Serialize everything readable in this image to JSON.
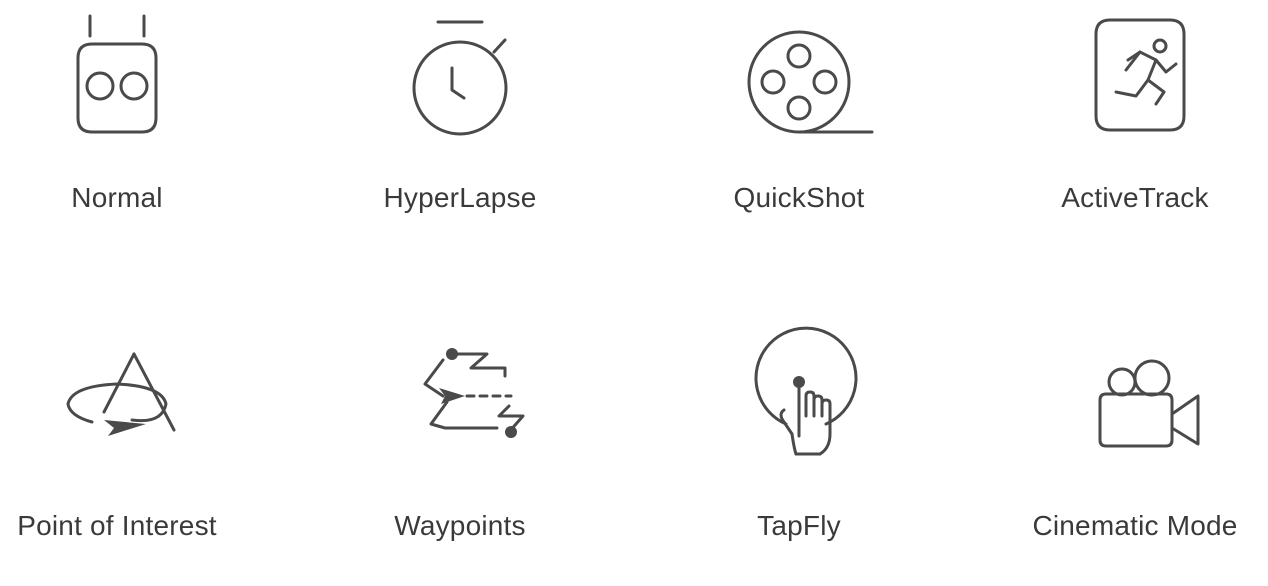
{
  "modes": [
    {
      "id": "normal",
      "label": "Normal",
      "icon": "remote-controller-icon"
    },
    {
      "id": "hyperlapse",
      "label": "HyperLapse",
      "icon": "stopwatch-icon"
    },
    {
      "id": "quickshot",
      "label": "QuickShot",
      "icon": "film-reel-icon"
    },
    {
      "id": "activetrack",
      "label": "ActiveTrack",
      "icon": "running-person-icon"
    },
    {
      "id": "poi",
      "label": "Point of Interest",
      "icon": "orbit-icon"
    },
    {
      "id": "waypoints",
      "label": "Waypoints",
      "icon": "waypoints-path-icon"
    },
    {
      "id": "tapfly",
      "label": "TapFly",
      "icon": "tap-finger-icon"
    },
    {
      "id": "cinematic",
      "label": "Cinematic Mode",
      "icon": "movie-camera-icon"
    }
  ],
  "colors": {
    "icon_stroke": "#4a4a4a",
    "label_text": "#3a3a3a",
    "background": "#ffffff"
  }
}
